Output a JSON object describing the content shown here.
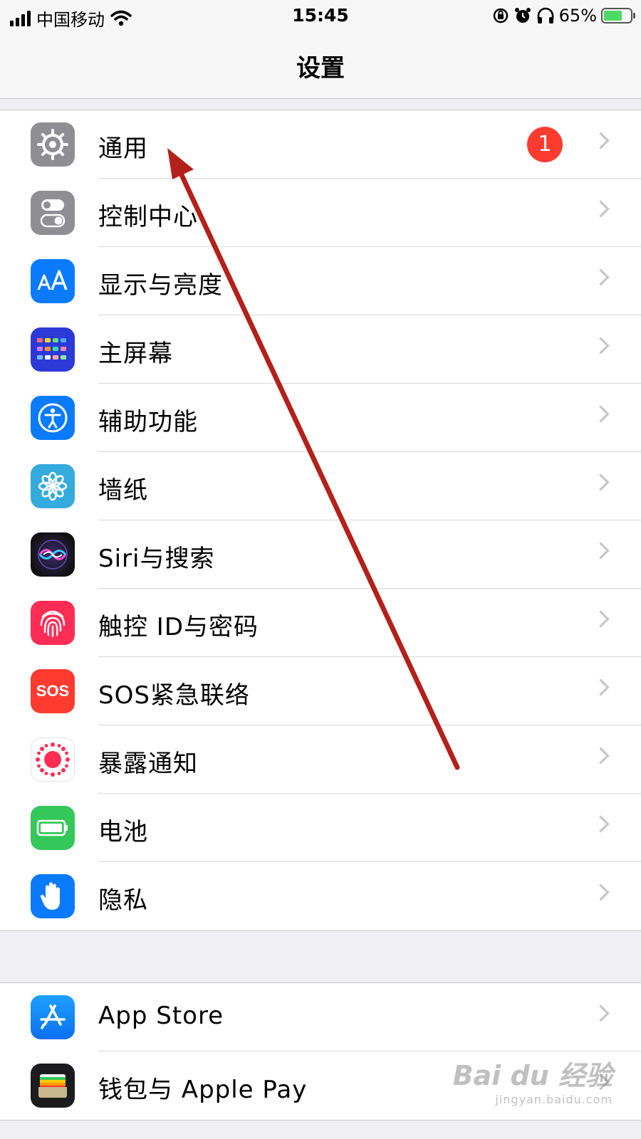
{
  "status_bar": {
    "carrier": "中国移动",
    "time": "15:45",
    "battery_percent": "65%",
    "battery_level": 0.65,
    "icons": [
      "signal-icon",
      "wifi-icon",
      "orientation-lock-icon",
      "alarm-icon",
      "headphones-icon",
      "battery-charging-icon"
    ]
  },
  "nav": {
    "title": "设置"
  },
  "groups": [
    {
      "items": [
        {
          "label": "通用",
          "icon": "gear-icon",
          "badge": "1"
        },
        {
          "label": "控制中心",
          "icon": "toggles-icon"
        },
        {
          "label": "显示与亮度",
          "icon": "text-size-icon"
        },
        {
          "label": "主屏幕",
          "icon": "home-grid-icon"
        },
        {
          "label": "辅助功能",
          "icon": "accessibility-icon"
        },
        {
          "label": "墙纸",
          "icon": "flower-icon"
        },
        {
          "label": "Siri与搜索",
          "icon": "siri-icon"
        },
        {
          "label": "触控 ID与密码",
          "icon": "fingerprint-icon"
        },
        {
          "label": "SOS紧急联络",
          "icon": "sos-icon",
          "icon_text": "SOS"
        },
        {
          "label": "暴露通知",
          "icon": "exposure-dots-icon"
        },
        {
          "label": "电池",
          "icon": "battery-icon"
        },
        {
          "label": "隐私",
          "icon": "hand-icon"
        }
      ]
    },
    {
      "items": [
        {
          "label": "App Store",
          "icon": "app-store-icon"
        },
        {
          "label": "钱包与 Apple Pay",
          "icon": "wallet-icon"
        }
      ]
    }
  ],
  "colors": {
    "badge": "#ff3b30",
    "annotation_arrow": "#b3211b",
    "general_icon": "#8e8e93",
    "display_icon": "#0a7aff",
    "sos_icon": "#ff3b30",
    "battery_icon": "#34c759"
  },
  "watermark": {
    "logo": "Bai du 经验",
    "url": "jingyan.baidu.com"
  }
}
